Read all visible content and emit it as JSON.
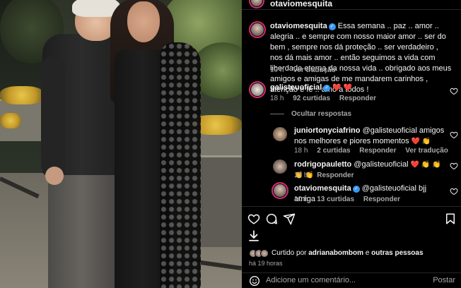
{
  "header": {
    "username": "otaviomesquita"
  },
  "caption": {
    "username": "otaviomesquita",
    "text": "Essa semana .. paz .. amor .. alegria .. e sempre com nosso maior amor .. ser do bem , sempre nos dá proteção .. ser verdadeiro , nos dá mais amor .. então seguimos a vida com liberdade eterna da nossa vida .. obrigado aos meus amigos e amigas de me mandarem carinhos , atenção e fé .. amo a todos !",
    "time": "19 h",
    "see_translation": "Ver tradução"
  },
  "comments": [
    {
      "username": "galisteuoficial",
      "text": "❤️ ❤️",
      "time": "18 h",
      "likes": "92 curtidas",
      "reply_label": "Responder"
    }
  ],
  "hide_replies": "Ocultar respostas",
  "replies": [
    {
      "username": "juniortonyciafrino",
      "text": "@galisteuoficial amigos nos melhores e piores momentos",
      "emoji": "❤️ 👏",
      "time": "18 h",
      "likes": "2 curtidas",
      "reply_label": "Responder",
      "see_translation": "Ver tradução"
    },
    {
      "username": "rodrigopauletto",
      "text": "@galisteuoficial",
      "emoji": "❤️ 👏 👏 👏 👏",
      "time": "17 h",
      "reply_label": "Responder"
    },
    {
      "username": "otaviomesquita",
      "text": "@galisteuoficial bjj amiga",
      "time": "10 h",
      "likes": "13 curtidas",
      "reply_label": "Responder"
    }
  ],
  "actions": {
    "icons": [
      "heart-icon",
      "comment-icon",
      "share-icon",
      "save-icon",
      "download-icon"
    ],
    "liked_prefix": "Curtido por",
    "liked_user": "adrianabombom",
    "liked_and": "e",
    "liked_others": "outras pessoas",
    "time_ago": "há 19 horas"
  },
  "comment_box": {
    "placeholder": "Adicione um comentário...",
    "post_label": "Postar"
  },
  "colors": {
    "background": "#000000",
    "text": "#f5f5f5",
    "muted": "#a8a8a8",
    "verified": "#3897f0",
    "heart": "#ed4956",
    "divider": "#262626"
  }
}
